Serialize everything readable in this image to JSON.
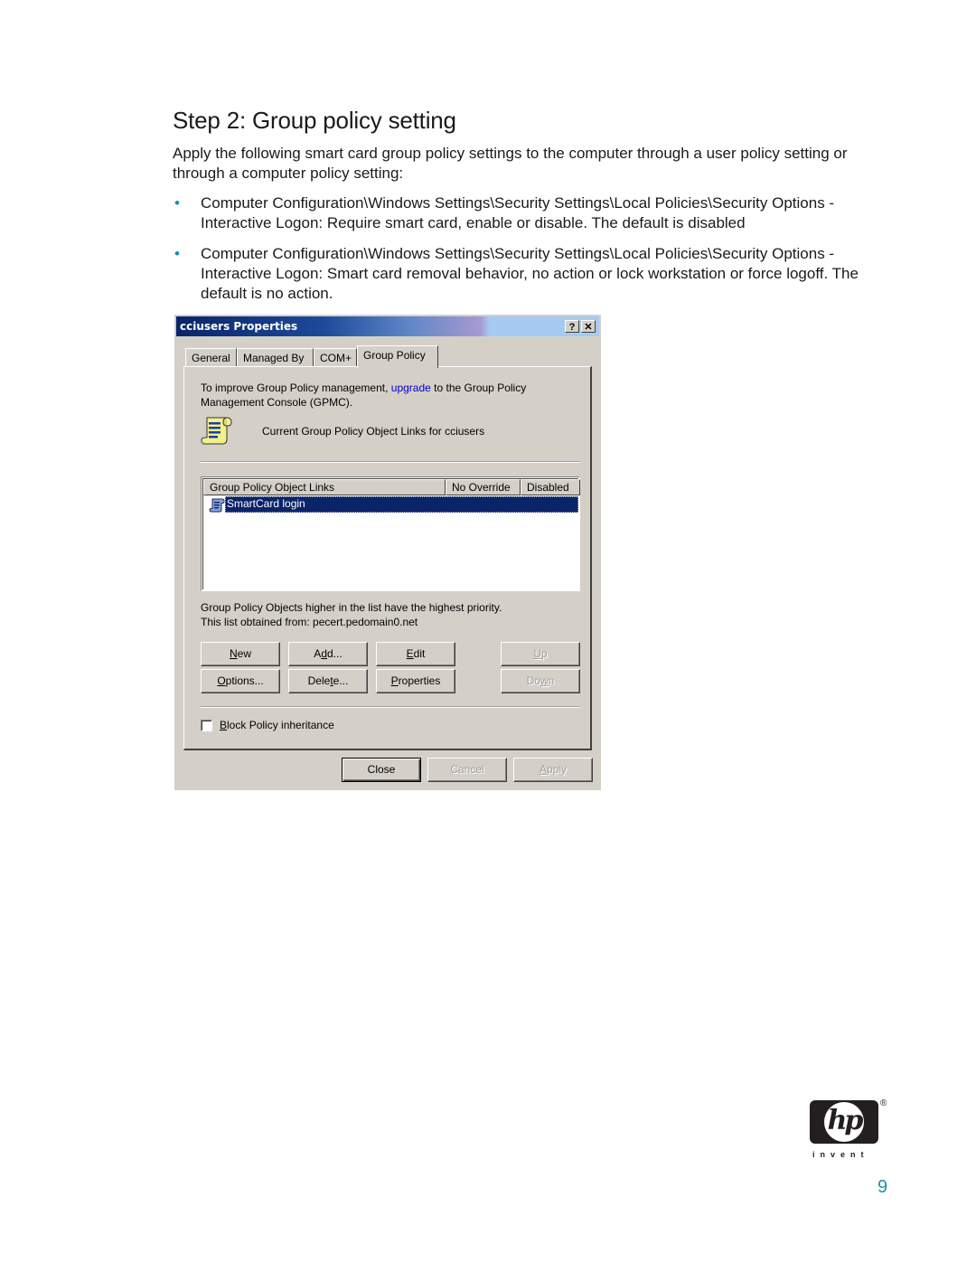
{
  "document": {
    "heading": "Step 2: Group policy setting",
    "intro": "Apply the following smart card group policy settings to the computer through a user policy setting or through a computer policy setting:",
    "bullets": [
      "Computer Configuration\\Windows Settings\\Security Settings\\Local Policies\\Security Options - Interactive Logon: Require smart card, enable or disable. The default is disabled",
      "Computer Configuration\\Windows Settings\\Security Settings\\Local Policies\\Security Options - Interactive Logon: Smart card removal behavior, no action or lock workstation or force logoff. The default is no action."
    ],
    "bullet_glyph": "•",
    "page_number": "9",
    "accent_color": "#1a8fb3"
  },
  "logo": {
    "letters": "hp",
    "registered": "®",
    "tagline": "invent"
  },
  "dialog": {
    "title": "cciusers Properties",
    "help_button": "?",
    "close_button": "✕",
    "tabs": [
      {
        "label": "General",
        "active": false
      },
      {
        "label": "Managed By",
        "active": false
      },
      {
        "label": "COM+",
        "active": false
      },
      {
        "label": "Group Policy",
        "active": true
      }
    ],
    "gpmc_text_before": "To improve Group Policy management, ",
    "gpmc_link": "upgrade",
    "gpmc_text_after": " to the Group Policy Management Console (GPMC).",
    "current_links_label": "Current Group Policy Object Links for cciusers",
    "list": {
      "columns": [
        "Group Policy Object Links",
        "No Override",
        "Disabled"
      ],
      "rows": [
        {
          "name": "SmartCard login",
          "no_override": "",
          "disabled": "",
          "selected": true
        }
      ]
    },
    "priority_note": "Group Policy Objects higher in the list have the highest priority.",
    "obtained_from": "This list obtained from: pecert.pedomain0.net",
    "buttons": {
      "new": {
        "pre": "",
        "key": "N",
        "post": "ew",
        "enabled": true
      },
      "add": {
        "pre": "A",
        "key": "d",
        "post": "d...",
        "enabled": true
      },
      "edit": {
        "pre": "",
        "key": "E",
        "post": "dit",
        "enabled": true
      },
      "up": {
        "pre": "",
        "key": "U",
        "post": "p",
        "enabled": false
      },
      "options": {
        "pre": "",
        "key": "O",
        "post": "ptions...",
        "enabled": true
      },
      "delete": {
        "pre": "Dele",
        "key": "t",
        "post": "e...",
        "enabled": true
      },
      "properties": {
        "pre": "",
        "key": "P",
        "post": "roperties",
        "enabled": true
      },
      "down": {
        "pre": "Do",
        "key": "w",
        "post": "n",
        "enabled": false
      }
    },
    "block_inheritance": {
      "pre": "",
      "key": "B",
      "post": "lock Policy inheritance",
      "checked": false
    },
    "footer": {
      "close": "Close",
      "cancel": "Cancel",
      "apply_key": "A",
      "apply_rest": "pply"
    }
  }
}
